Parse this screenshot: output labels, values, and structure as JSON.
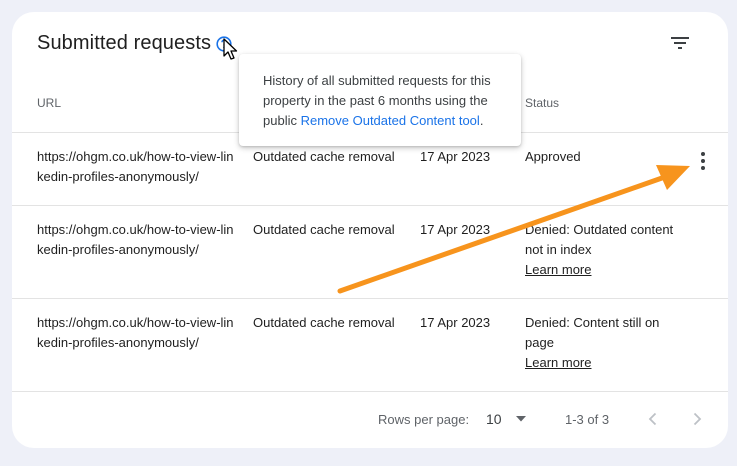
{
  "card": {
    "title": "Submitted requests",
    "icons": {
      "help": "help-circle-icon",
      "cursor": "mouse-pointer-icon",
      "filter": "filter-list-icon",
      "more": "more-vert-icon"
    }
  },
  "table": {
    "columns": {
      "url": "URL",
      "status": "Status"
    },
    "rows": [
      {
        "url": "https://ohgm.co.uk/how-to-view-linkedin-profiles-anonymously/",
        "type": "Outdated cache removal",
        "date": "17 Apr 2023",
        "status": "Approved",
        "link": ""
      },
      {
        "url": "https://ohgm.co.uk/how-to-view-linkedin-profiles-anonymously/",
        "type": "Outdated cache removal",
        "date": "17 Apr 2023",
        "status": "Denied: Outdated content not in index",
        "link": "Learn more"
      },
      {
        "url": "https://ohgm.co.uk/how-to-view-linkedin-profiles-anonymously/",
        "type": "Outdated cache removal",
        "date": "17 Apr 2023",
        "status": "Denied: Content still on page",
        "link": "Learn more"
      }
    ]
  },
  "tooltip": {
    "text": "History of all submitted requests for this property in the past 6 months using the public ",
    "link": "Remove Outdated Content tool",
    "end": "."
  },
  "footer": {
    "rows_per_page_label": "Rows per page:",
    "rows_per_page_value": "10",
    "range": "1-3 of 3"
  },
  "colors": {
    "accent": "#1a73e8",
    "annotation_arrow": "#f7941d",
    "background": "#eef0f8"
  }
}
